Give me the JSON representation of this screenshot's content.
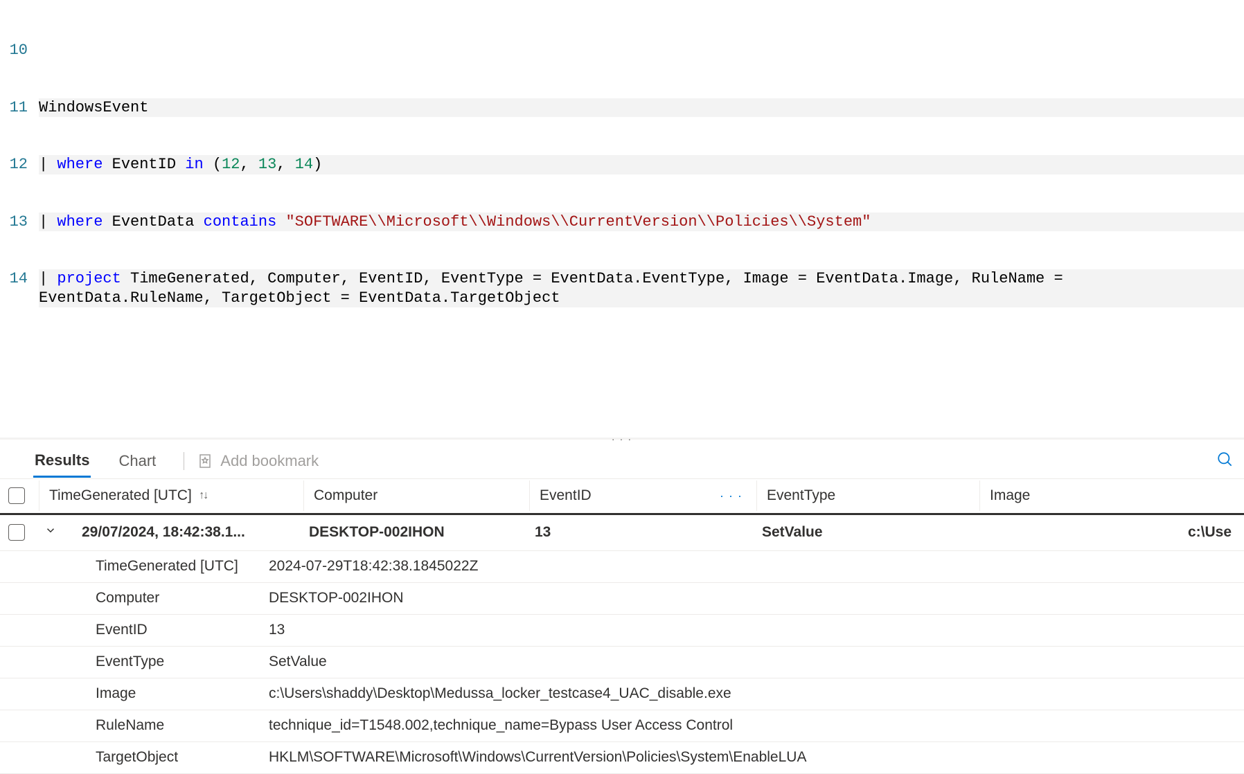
{
  "editor": {
    "lines": [
      {
        "n": 10,
        "hl": false
      },
      {
        "n": 11,
        "hl": true
      },
      {
        "n": 12,
        "hl": true
      },
      {
        "n": 13,
        "hl": true
      },
      {
        "n": 14,
        "hl": true
      }
    ],
    "query": {
      "table": "WindowsEvent",
      "where1_field": "EventID",
      "where1_op": "in",
      "where1_vals": "(12, 13, 14)",
      "where2_field": "EventData",
      "where2_op": "contains",
      "where2_val": "\"SOFTWARE\\\\Microsoft\\\\Windows\\\\CurrentVersion\\\\Policies\\\\System\"",
      "project": "TimeGenerated, Computer, EventID, EventType = EventData.EventType, Image = EventData.Image, RuleName = EventData.RuleName, TargetObject = EventData.TargetObject"
    }
  },
  "tabs": {
    "results": "Results",
    "chart": "Chart",
    "bookmark": "Add bookmark"
  },
  "columns": {
    "time": "TimeGenerated [UTC]",
    "computer": "Computer",
    "eventid": "EventID",
    "eventtype": "EventType",
    "image": "Image"
  },
  "row": {
    "time": "29/07/2024, 18:42:38.1...",
    "computer": "DESKTOP-002IHON",
    "eventid": "13",
    "eventtype": "SetValue",
    "image": "c:\\Use"
  },
  "details": [
    {
      "k": "TimeGenerated [UTC]",
      "v": "2024-07-29T18:42:38.1845022Z"
    },
    {
      "k": "Computer",
      "v": "DESKTOP-002IHON"
    },
    {
      "k": "EventID",
      "v": "13"
    },
    {
      "k": "EventType",
      "v": "SetValue"
    },
    {
      "k": "Image",
      "v": "c:\\Users\\shaddy\\Desktop\\Medussa_locker_testcase4_UAC_disable.exe"
    },
    {
      "k": "RuleName",
      "v": "technique_id=T1548.002,technique_name=Bypass User Access Control"
    },
    {
      "k": "TargetObject",
      "v": "HKLM\\SOFTWARE\\Microsoft\\Windows\\CurrentVersion\\Policies\\System\\EnableLUA"
    }
  ]
}
